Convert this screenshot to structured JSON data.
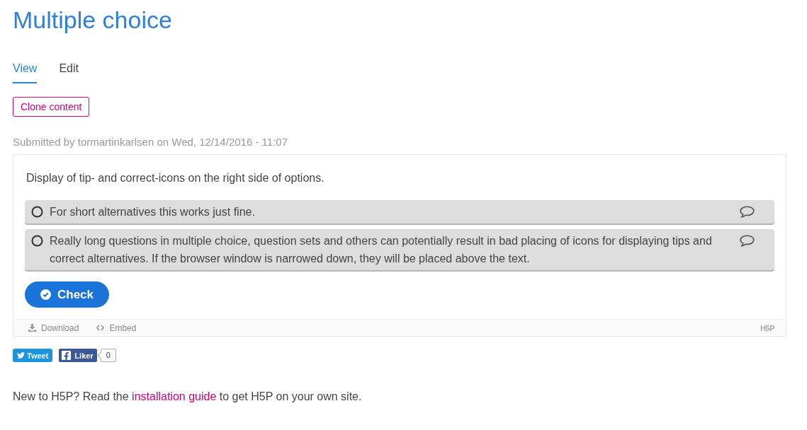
{
  "page": {
    "title": "Multiple choice"
  },
  "tabs": [
    {
      "label": "View",
      "selected": true
    },
    {
      "label": "Edit",
      "selected": false
    }
  ],
  "clone_button": "Clone content",
  "submitted": "Submitted by tormartinkarlsen on Wed, 12/14/2016 - 11:07",
  "h5p": {
    "question": "Display of tip- and correct-icons on the right side of options.",
    "options": [
      {
        "text": "For short alternatives this works just fine.",
        "selected": false
      },
      {
        "text": "Really long questions in multiple choice, question sets and others can potentially result in bad placing of icons for displaying tips and correct alternatives. If the browser window is narrowed down, they will be placed above the text.",
        "selected": false
      }
    ],
    "check_button": "Check",
    "actions": [
      {
        "kind": "download",
        "label": "Download"
      },
      {
        "kind": "embed",
        "label": "Embed"
      }
    ],
    "logo": "H5P"
  },
  "share": {
    "tweet": "Tweet",
    "like": "Liker",
    "like_count": "0"
  },
  "note": {
    "before": "New to H5P? Read the ",
    "link": "installation guide",
    "after": " to get H5P on your own site."
  }
}
